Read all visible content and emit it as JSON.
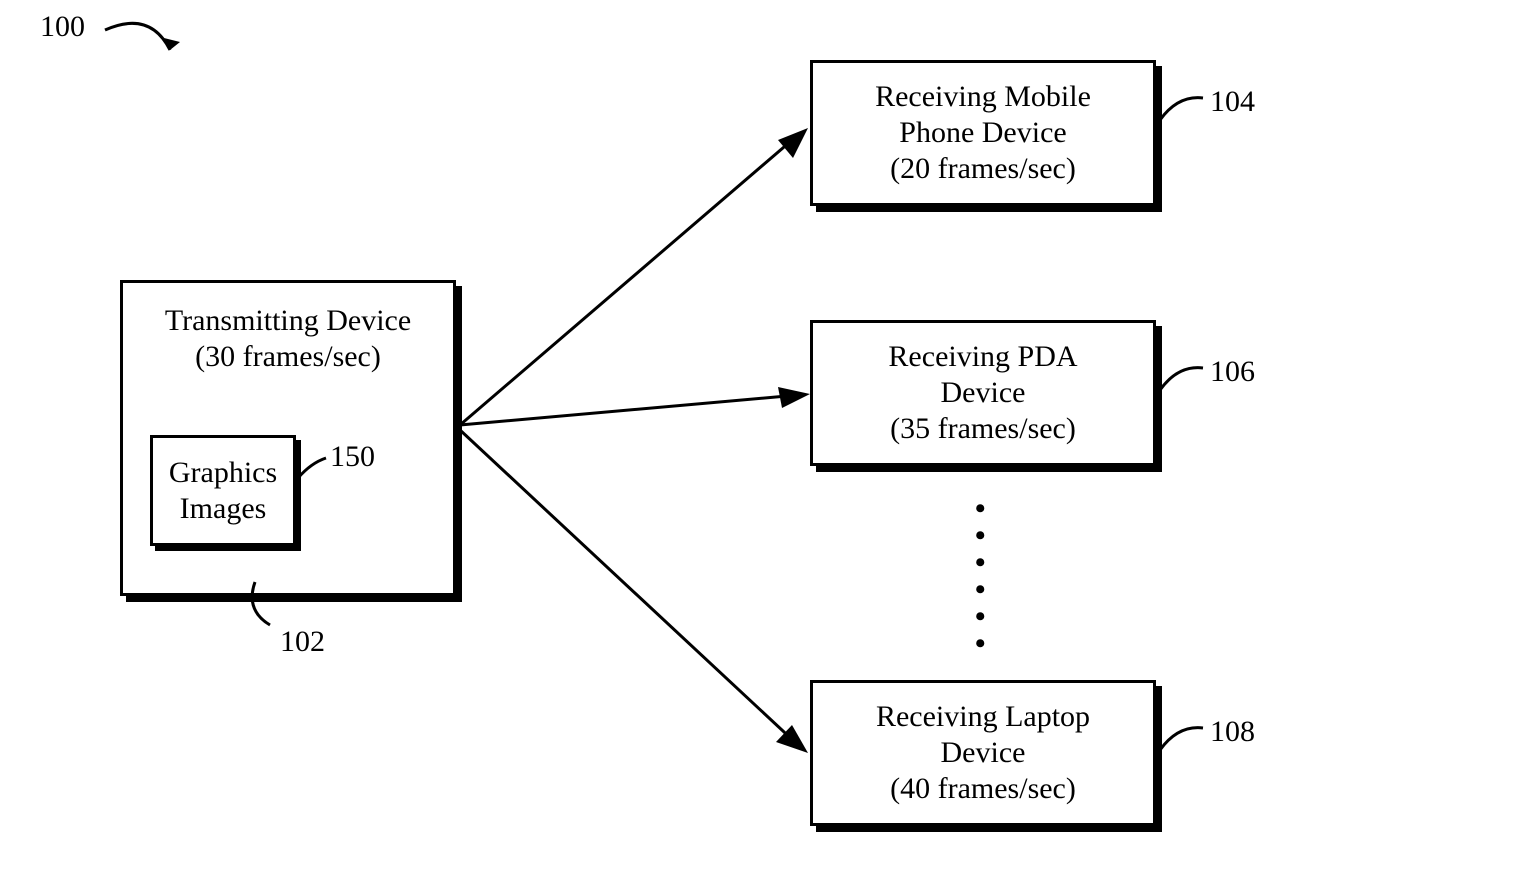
{
  "diagram_label": "100",
  "transmitter": {
    "title": "Transmitting Device",
    "rate": "(30 frames/sec)",
    "ref": "102",
    "inner": {
      "line1": "Graphics",
      "line2": "Images",
      "ref": "150"
    }
  },
  "receivers": [
    {
      "line1": "Receiving Mobile",
      "line2": "Phone Device",
      "rate": "(20 frames/sec)",
      "ref": "104"
    },
    {
      "line1": "Receiving PDA",
      "line2": "Device",
      "rate": "(35 frames/sec)",
      "ref": "106"
    },
    {
      "line1": "Receiving Laptop",
      "line2": "Device",
      "rate": "(40 frames/sec)",
      "ref": "108"
    }
  ],
  "ellipsis": "…"
}
